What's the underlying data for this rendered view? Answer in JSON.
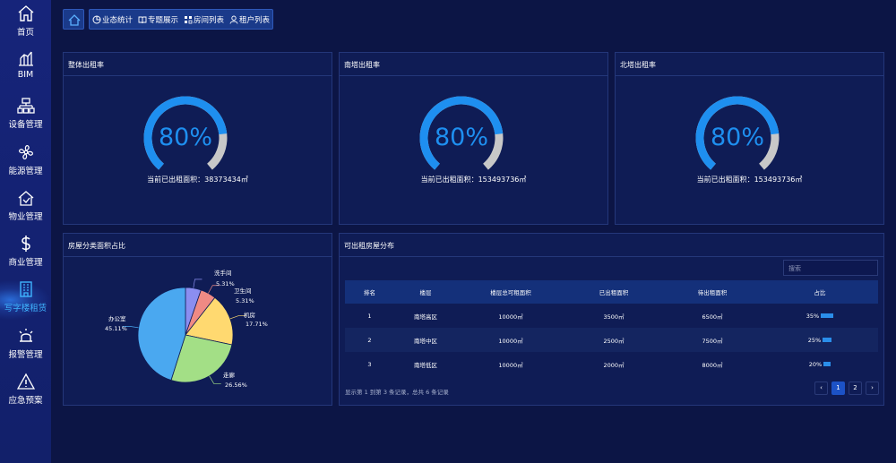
{
  "sidebar": {
    "items": [
      {
        "label": "首页",
        "icon": "home-icon"
      },
      {
        "label": "BIM",
        "icon": "bim-icon"
      },
      {
        "label": "设备管理",
        "icon": "device-icon"
      },
      {
        "label": "能源管理",
        "icon": "fan-icon"
      },
      {
        "label": "物业管理",
        "icon": "property-icon"
      },
      {
        "label": "商业管理",
        "icon": "dollar-icon"
      },
      {
        "label": "写字楼租赁",
        "icon": "building-icon"
      },
      {
        "label": "报警管理",
        "icon": "alarm-icon"
      },
      {
        "label": "应急预案",
        "icon": "warning-icon"
      }
    ],
    "active_index": 6
  },
  "topbar": {
    "tabs": [
      {
        "label": "业态统计",
        "icon": "pie-chart-icon"
      },
      {
        "label": "专题展示",
        "icon": "book-icon"
      },
      {
        "label": "房间列表",
        "icon": "grid-icon"
      },
      {
        "label": "租户列表",
        "icon": "user-icon"
      }
    ]
  },
  "gauges": [
    {
      "title": "整体出租率",
      "value": "80%",
      "ratio": 0.8,
      "caption": "当前已出租面积：38373434㎡"
    },
    {
      "title": "南塔出租率",
      "value": "80%",
      "ratio": 0.8,
      "caption": "当前已出租面积：153493736㎡"
    },
    {
      "title": "北塔出租率",
      "value": "80%",
      "ratio": 0.8,
      "caption": "当前已出租面积：153493736㎡"
    }
  ],
  "pie_panel": {
    "title": "房屋分类面积占比"
  },
  "chart_data": {
    "type": "pie",
    "slices": [
      {
        "name": "洗手间",
        "value": 5.31,
        "label": "5.31%",
        "color": "#8b8ef0"
      },
      {
        "name": "卫生间",
        "value": 5.31,
        "label": "5.31%",
        "color": "#f08a84"
      },
      {
        "name": "机房",
        "value": 17.71,
        "label": "17.71%",
        "color": "#ffd970"
      },
      {
        "name": "走廊",
        "value": 26.56,
        "label": "26.56%",
        "color": "#a3df86"
      },
      {
        "name": "办公室",
        "value": 45.11,
        "label": "45.11%",
        "color": "#4aa8f0"
      }
    ]
  },
  "table_panel": {
    "title": "可出租房屋分布",
    "search_placeholder": "搜索",
    "headers": [
      "排名",
      "楼层",
      "楼层总可租面积",
      "已出租面积",
      "待出租面积",
      "占比"
    ],
    "rows": [
      {
        "rank": "1",
        "floor": "南塔高区",
        "total": "10000㎡",
        "rented": "3500㎡",
        "pending": "6500㎡",
        "pct": "35%",
        "ratio": 0.35
      },
      {
        "rank": "2",
        "floor": "南塔中区",
        "total": "10000㎡",
        "rented": "2500㎡",
        "pending": "7500㎡",
        "pct": "25%",
        "ratio": 0.25
      },
      {
        "rank": "3",
        "floor": "南塔低区",
        "total": "10000㎡",
        "rented": "2000㎡",
        "pending": "8000㎡",
        "pct": "20%",
        "ratio": 0.2
      }
    ],
    "footer": "显示第 1 到第 3 条记录，总共 6 条记录",
    "pagination": {
      "prev": "‹",
      "pages": [
        "1",
        "2"
      ],
      "next": "›",
      "current": "1"
    }
  },
  "colors": {
    "accent": "#1e8ff0",
    "background": "#0c1545",
    "panel": "#0f1c55",
    "gauge_track": "#c8c8c8"
  }
}
